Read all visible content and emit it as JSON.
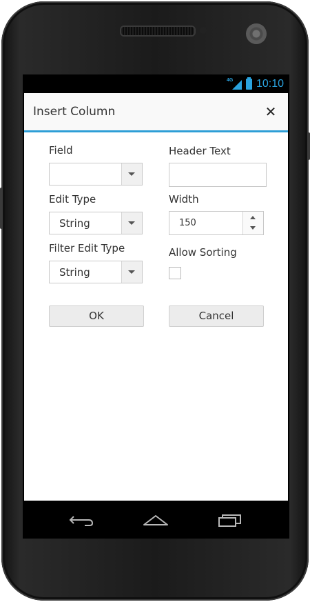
{
  "status_bar": {
    "network": "4G",
    "time": "10:10",
    "accent_color": "#2aa3df"
  },
  "dialog": {
    "title": "Insert Column",
    "close_icon": "close-icon",
    "header_border_color": "#2d9ed6",
    "field": {
      "label": "Field",
      "value": ""
    },
    "header_text": {
      "label": "Header Text",
      "value": ""
    },
    "edit_type": {
      "label": "Edit Type",
      "value": "String"
    },
    "width": {
      "label": "Width",
      "value": "150"
    },
    "filter_edit_type": {
      "label": "Filter Edit Type",
      "value": "String"
    },
    "allow_sorting": {
      "label": "Allow Sorting",
      "checked": false
    },
    "ok_label": "OK",
    "cancel_label": "Cancel"
  },
  "nav_bar": {
    "icons": [
      "back-icon",
      "home-icon",
      "recent-apps-icon"
    ]
  }
}
